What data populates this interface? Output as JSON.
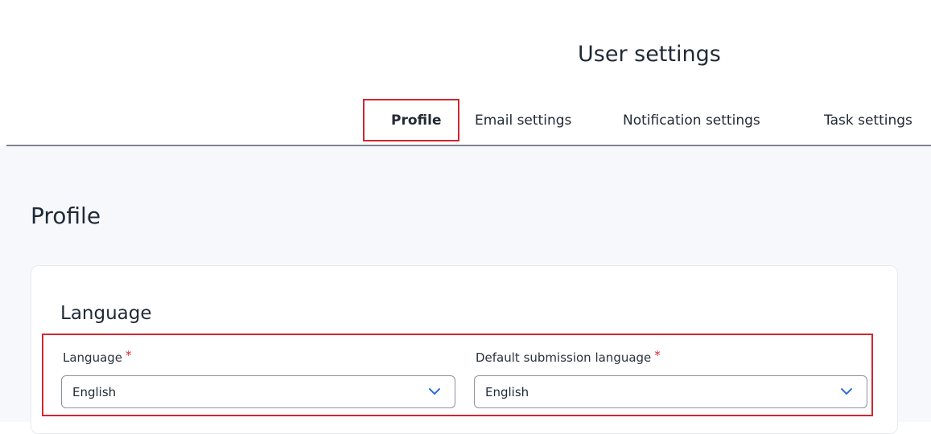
{
  "header": {
    "title": "User settings"
  },
  "tabs": [
    {
      "label": "Profile",
      "active": true
    },
    {
      "label": "Email settings",
      "active": false
    },
    {
      "label": "Notification settings",
      "active": false
    },
    {
      "label": "Task settings",
      "active": false
    }
  ],
  "main": {
    "section_title": "Profile",
    "card": {
      "title": "Language",
      "fields": [
        {
          "label": "Language",
          "required_marker": "*",
          "value": "English"
        },
        {
          "label": "Default submission language",
          "required_marker": "*",
          "value": "English"
        }
      ]
    }
  },
  "colors": {
    "highlight": "#d22630",
    "background": "#f6f8fb",
    "divider": "#7c8490"
  },
  "icons": {
    "dropdown": "chevron-down-icon"
  }
}
